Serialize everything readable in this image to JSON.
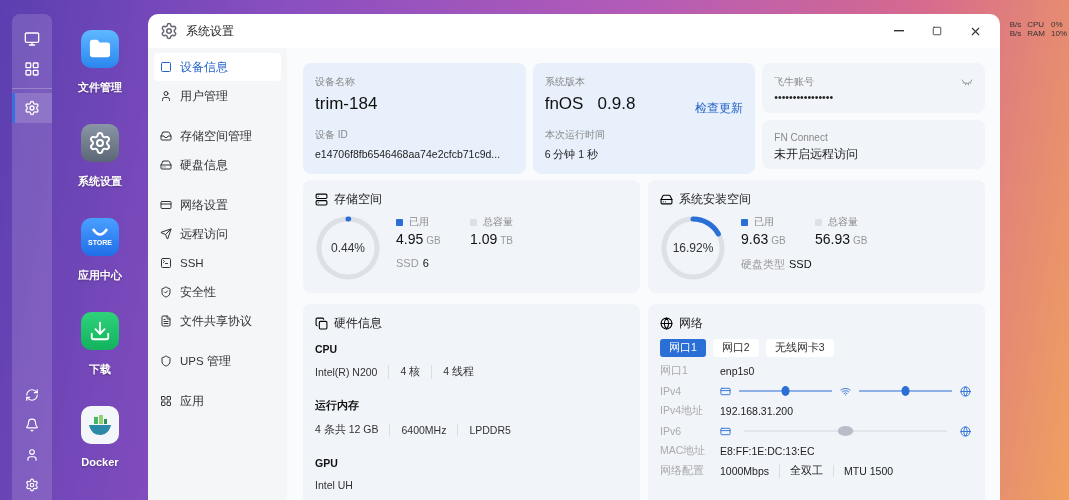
{
  "status": [
    {
      "unit": "B/s",
      "label": "CPU",
      "value": "0%"
    },
    {
      "unit": "B/s",
      "label": "RAM",
      "value": "10%"
    }
  ],
  "dock": {
    "items": [
      {
        "selected": false
      },
      {
        "selected": false
      },
      {
        "selected": true
      }
    ]
  },
  "desktop": [
    {
      "label": "文件管理"
    },
    {
      "label": "系统设置"
    },
    {
      "label": "应用中心",
      "badge": "STORE"
    },
    {
      "label": "下载"
    },
    {
      "label": "Docker"
    }
  ],
  "window": {
    "title": "系统设置"
  },
  "sidebar": {
    "groups": [
      [
        {
          "label": "设备信息",
          "selected": true
        },
        {
          "label": "用户管理",
          "selected": false
        }
      ],
      [
        {
          "label": "存储空间管理",
          "selected": false
        },
        {
          "label": "硬盘信息",
          "selected": false
        }
      ],
      [
        {
          "label": "网络设置",
          "selected": false
        },
        {
          "label": "远程访问",
          "selected": false
        },
        {
          "label": "SSH",
          "selected": false
        },
        {
          "label": "安全性",
          "selected": false
        },
        {
          "label": "文件共享协议",
          "selected": false
        }
      ],
      [
        {
          "label": "UPS 管理",
          "selected": false
        }
      ],
      [
        {
          "label": "应用",
          "selected": false
        }
      ]
    ]
  },
  "device": {
    "name_label": "设备名称",
    "name": "trim-184",
    "id_label": "设备 ID",
    "id": "e14706f8fb6546468aa74e2cfcb71c9d..."
  },
  "system": {
    "version_label": "系统版本",
    "os": "fnOS",
    "version": "0.9.8",
    "update": "检查更新",
    "uptime_label": "本次运行时间",
    "uptime": "6 分钟 1 秒"
  },
  "account": {
    "label": "飞牛账号",
    "value": "••••••••••••••••"
  },
  "connect": {
    "label": "FN Connect",
    "value": "未开启远程访问"
  },
  "storage": [
    {
      "title": "存储空间",
      "percent": "0.44%",
      "level": 0.0044,
      "used_label": "已用",
      "used": "4.95",
      "used_unit": "GB",
      "total_label": "总容量",
      "total": "1.09",
      "total_unit": "TB",
      "extra_label": "SSD",
      "extra": "6"
    },
    {
      "title": "系统安装空间",
      "percent": "16.92%",
      "level": 0.1692,
      "used_label": "已用",
      "used": "9.63",
      "used_unit": "GB",
      "total_label": "总容量",
      "total": "56.93",
      "total_unit": "GB",
      "extra_label": "硬盘类型",
      "extra": "SSD"
    }
  ],
  "hardware": {
    "title": "硬件信息",
    "sections": [
      {
        "title": "CPU",
        "values": [
          "Intel(R) N200",
          "4 核",
          "4 线程"
        ]
      },
      {
        "title": "运行内存",
        "values": [
          "4 条共 12 GB",
          "6400MHz",
          "LPDDR5"
        ]
      },
      {
        "title": "GPU",
        "values": [
          "Intel UH"
        ]
      }
    ]
  },
  "network": {
    "title": "网络",
    "tabs": [
      {
        "label": "网口1",
        "selected": true
      },
      {
        "label": "网口2",
        "selected": false
      },
      {
        "label": "无线网卡3",
        "selected": false
      }
    ],
    "rows": [
      {
        "kind": "text",
        "label": "网口1",
        "values": [
          "enp1s0"
        ]
      },
      {
        "kind": "path",
        "label": "IPv4",
        "hops": [
          {
            "ok": true
          },
          {
            "ok": true
          }
        ]
      },
      {
        "kind": "text",
        "label": "IPv4地址",
        "values": [
          "192.168.31.200"
        ]
      },
      {
        "kind": "path",
        "label": "IPv6",
        "hops": [
          {
            "ok": false
          }
        ]
      },
      {
        "kind": "text",
        "label": "MAC地址",
        "values": [
          "E8:FF:1E:DC:13:EC"
        ]
      },
      {
        "kind": "text",
        "label": "网络配置",
        "values": [
          "1000Mbps",
          "全双工",
          "MTU 1500"
        ]
      }
    ]
  }
}
